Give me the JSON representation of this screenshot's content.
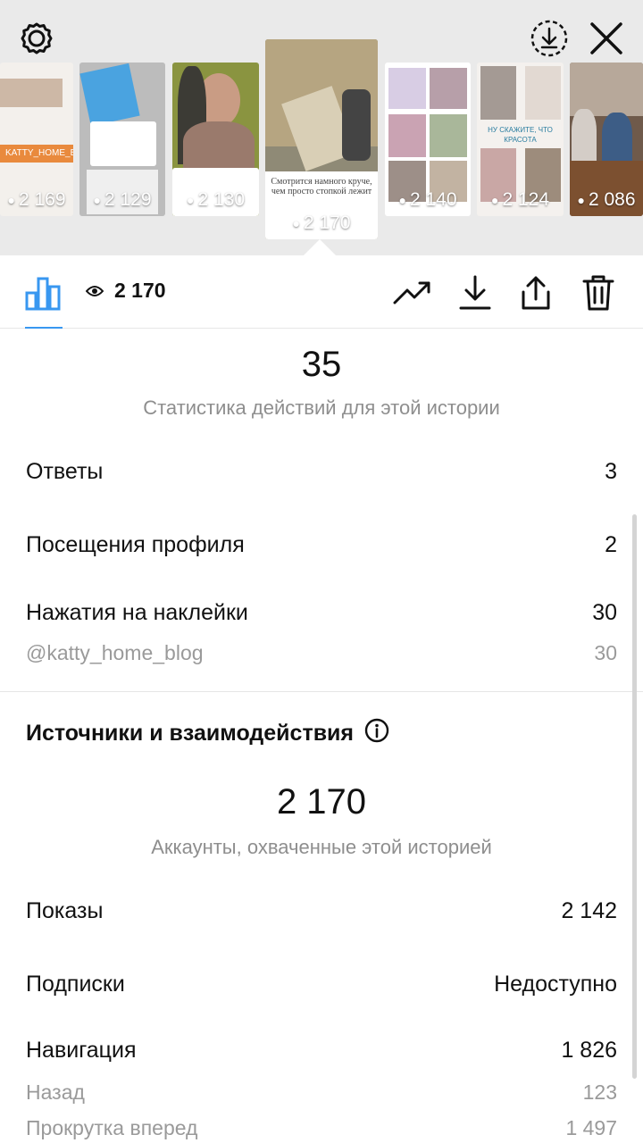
{
  "header": {
    "icons": [
      "gear-icon",
      "download-circle-icon",
      "close-icon"
    ]
  },
  "stories": [
    {
      "views": "2 169",
      "label": "KATTY_HOME_BLOG"
    },
    {
      "views": "2 129"
    },
    {
      "views": "2 130"
    },
    {
      "views": "2 170",
      "caption": "Смотрится намного круче, чем просто стопкой лежит",
      "selected": true
    },
    {
      "views": "2 140"
    },
    {
      "views": "2 124",
      "caption": "НУ СКАЖИТЕ, ЧТО КРАСОТА"
    },
    {
      "views": "2 086"
    }
  ],
  "toolbar": {
    "views": "2 170",
    "icons": [
      "bar-chart-icon",
      "eye-icon",
      "trend-icon",
      "download-icon",
      "share-icon",
      "trash-icon"
    ]
  },
  "interactions": {
    "total": "35",
    "caption": "Статистика действий для этой истории",
    "rows": [
      {
        "label": "Ответы",
        "value": "3"
      },
      {
        "label": "Посещения профиля",
        "value": "2"
      },
      {
        "label": "Нажатия на наклейки",
        "value": "30"
      },
      {
        "label": "@katty_home_blog",
        "value": "30"
      }
    ]
  },
  "sources": {
    "title": "Источники и взаимодействия",
    "total": "2 170",
    "caption": "Аккаунты, охваченные этой историей",
    "rows": [
      {
        "label": "Показы",
        "value": "2 142"
      },
      {
        "label": "Подписки",
        "value": "Недоступно"
      },
      {
        "label": "Навигация",
        "value": "1 826"
      },
      {
        "label": "Назад",
        "value": "123"
      },
      {
        "label": "Прокрутка вперед",
        "value": "1 497"
      }
    ]
  },
  "colors": {
    "accent": "#3897f0",
    "muted": "#8e8e8e",
    "header_bg": "#eaeaea"
  }
}
